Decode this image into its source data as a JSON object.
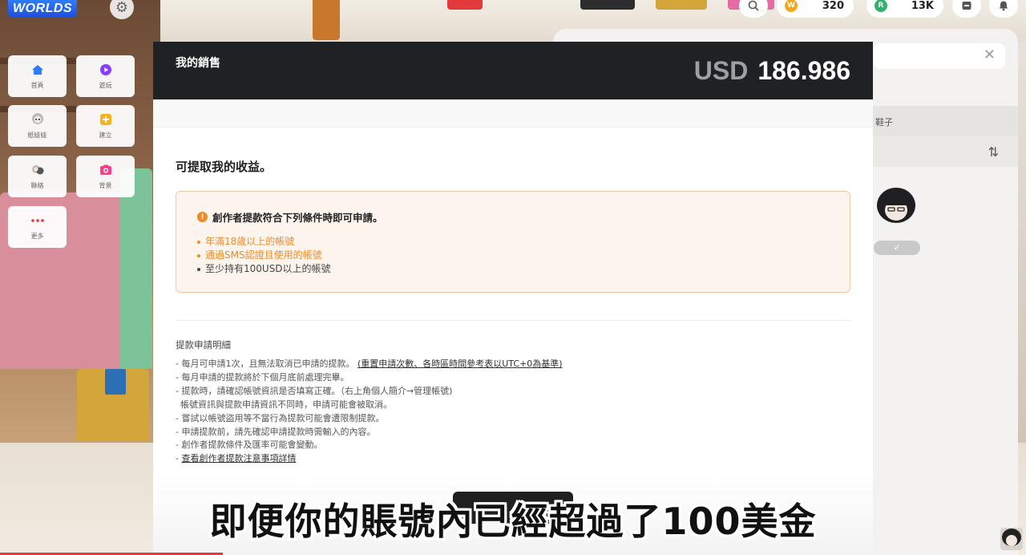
{
  "app": {
    "logo_text": "WORLDS"
  },
  "hud": {
    "coins": {
      "amount": "320",
      "badge": "W",
      "color": "#f2a81d"
    },
    "gems": {
      "amount": "13K",
      "badge": "R",
      "color": "#2fb36b"
    }
  },
  "menu": {
    "items": [
      {
        "label": "首頁",
        "icon": "home-icon",
        "color": "#2f7bff"
      },
      {
        "label": "遊玩",
        "icon": "play-icon",
        "color": "#8b3dff"
      },
      {
        "label": "紙娃娃",
        "icon": "avatar-icon",
        "color": "#888888"
      },
      {
        "label": "建立",
        "icon": "create-icon",
        "color": "#f5b321"
      },
      {
        "label": "聯絡",
        "icon": "contact-icon",
        "color": "#888888"
      },
      {
        "label": "背景",
        "icon": "camera-icon",
        "color": "#ff3d8b"
      },
      {
        "label": "更多",
        "icon": "more-icon",
        "color": "#e53935"
      }
    ]
  },
  "right_panel": {
    "row_label": "鞋子"
  },
  "modal": {
    "title": "我的銷售",
    "balance_currency": "USD",
    "balance_amount": "186.986",
    "section_title": "可提取我的收益。",
    "notice": {
      "heading": "創作者提款符合下列條件時即可申請。",
      "conditions": [
        {
          "text": "年滿18歲以上的帳號",
          "met": false
        },
        {
          "text": "通過SMS認證且使用的帳號",
          "met": false
        },
        {
          "text": "至少持有100USD以上的帳號",
          "met": true
        }
      ]
    },
    "details_title": "提款申請明細",
    "details": [
      "-  每月可申請1次，且無法取消已申請的提款。",
      "(重置申請次數、各時區時間參考表以UTC+0為基準)",
      "- 每月申請的提款將於下個月底前處理完畢。",
      "- 提款時，請確認帳號資訊是否填寫正確。（右上角個人簡介→管理帳號)",
      "  帳號資訊與提款申請資訊不同時，申請可能會被取消。",
      "- 嘗試以帳號盜用等不當行為提款可能會遭限制提款。",
      "- 申請提款前，請先確認申請提款時需輸入的內容。",
      "- 創作者提款條件及匯率可能會變動。",
      "- ",
      "查看創作者提款注意事項詳情"
    ]
  },
  "subtitle": "即便你的賬號內已經超過了100美金",
  "colors": {
    "header_bg": "#202124",
    "accent_orange": "#f08a24",
    "notice_bg": "#fdf4ed",
    "notice_border": "#f0c8a6"
  }
}
